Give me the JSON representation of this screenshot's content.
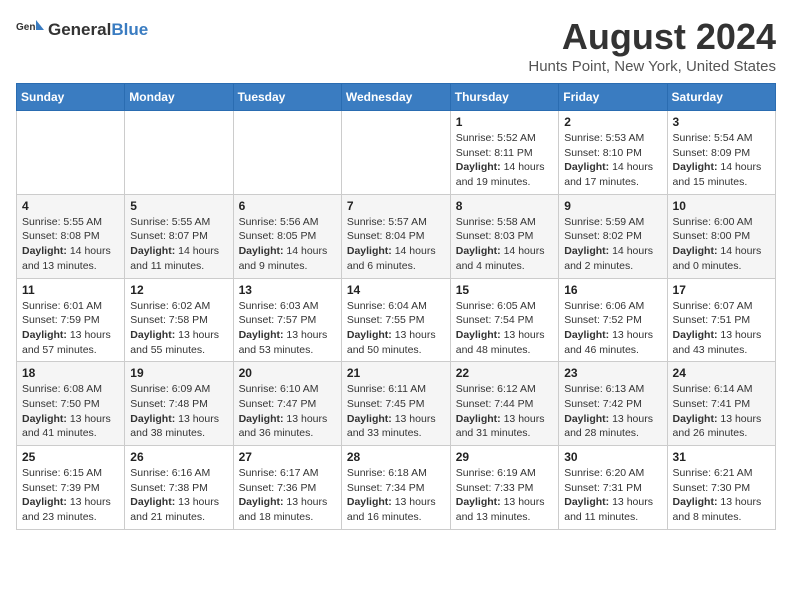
{
  "header": {
    "logo_general": "General",
    "logo_blue": "Blue",
    "month": "August 2024",
    "location": "Hunts Point, New York, United States"
  },
  "weekdays": [
    "Sunday",
    "Monday",
    "Tuesday",
    "Wednesday",
    "Thursday",
    "Friday",
    "Saturday"
  ],
  "weeks": [
    [
      {
        "day": "",
        "text": ""
      },
      {
        "day": "",
        "text": ""
      },
      {
        "day": "",
        "text": ""
      },
      {
        "day": "",
        "text": ""
      },
      {
        "day": "1",
        "text": "Sunrise: 5:52 AM\nSunset: 8:11 PM\nDaylight: 14 hours and 19 minutes."
      },
      {
        "day": "2",
        "text": "Sunrise: 5:53 AM\nSunset: 8:10 PM\nDaylight: 14 hours and 17 minutes."
      },
      {
        "day": "3",
        "text": "Sunrise: 5:54 AM\nSunset: 8:09 PM\nDaylight: 14 hours and 15 minutes."
      }
    ],
    [
      {
        "day": "4",
        "text": "Sunrise: 5:55 AM\nSunset: 8:08 PM\nDaylight: 14 hours and 13 minutes."
      },
      {
        "day": "5",
        "text": "Sunrise: 5:55 AM\nSunset: 8:07 PM\nDaylight: 14 hours and 11 minutes."
      },
      {
        "day": "6",
        "text": "Sunrise: 5:56 AM\nSunset: 8:05 PM\nDaylight: 14 hours and 9 minutes."
      },
      {
        "day": "7",
        "text": "Sunrise: 5:57 AM\nSunset: 8:04 PM\nDaylight: 14 hours and 6 minutes."
      },
      {
        "day": "8",
        "text": "Sunrise: 5:58 AM\nSunset: 8:03 PM\nDaylight: 14 hours and 4 minutes."
      },
      {
        "day": "9",
        "text": "Sunrise: 5:59 AM\nSunset: 8:02 PM\nDaylight: 14 hours and 2 minutes."
      },
      {
        "day": "10",
        "text": "Sunrise: 6:00 AM\nSunset: 8:00 PM\nDaylight: 14 hours and 0 minutes."
      }
    ],
    [
      {
        "day": "11",
        "text": "Sunrise: 6:01 AM\nSunset: 7:59 PM\nDaylight: 13 hours and 57 minutes."
      },
      {
        "day": "12",
        "text": "Sunrise: 6:02 AM\nSunset: 7:58 PM\nDaylight: 13 hours and 55 minutes."
      },
      {
        "day": "13",
        "text": "Sunrise: 6:03 AM\nSunset: 7:57 PM\nDaylight: 13 hours and 53 minutes."
      },
      {
        "day": "14",
        "text": "Sunrise: 6:04 AM\nSunset: 7:55 PM\nDaylight: 13 hours and 50 minutes."
      },
      {
        "day": "15",
        "text": "Sunrise: 6:05 AM\nSunset: 7:54 PM\nDaylight: 13 hours and 48 minutes."
      },
      {
        "day": "16",
        "text": "Sunrise: 6:06 AM\nSunset: 7:52 PM\nDaylight: 13 hours and 46 minutes."
      },
      {
        "day": "17",
        "text": "Sunrise: 6:07 AM\nSunset: 7:51 PM\nDaylight: 13 hours and 43 minutes."
      }
    ],
    [
      {
        "day": "18",
        "text": "Sunrise: 6:08 AM\nSunset: 7:50 PM\nDaylight: 13 hours and 41 minutes."
      },
      {
        "day": "19",
        "text": "Sunrise: 6:09 AM\nSunset: 7:48 PM\nDaylight: 13 hours and 38 minutes."
      },
      {
        "day": "20",
        "text": "Sunrise: 6:10 AM\nSunset: 7:47 PM\nDaylight: 13 hours and 36 minutes."
      },
      {
        "day": "21",
        "text": "Sunrise: 6:11 AM\nSunset: 7:45 PM\nDaylight: 13 hours and 33 minutes."
      },
      {
        "day": "22",
        "text": "Sunrise: 6:12 AM\nSunset: 7:44 PM\nDaylight: 13 hours and 31 minutes."
      },
      {
        "day": "23",
        "text": "Sunrise: 6:13 AM\nSunset: 7:42 PM\nDaylight: 13 hours and 28 minutes."
      },
      {
        "day": "24",
        "text": "Sunrise: 6:14 AM\nSunset: 7:41 PM\nDaylight: 13 hours and 26 minutes."
      }
    ],
    [
      {
        "day": "25",
        "text": "Sunrise: 6:15 AM\nSunset: 7:39 PM\nDaylight: 13 hours and 23 minutes."
      },
      {
        "day": "26",
        "text": "Sunrise: 6:16 AM\nSunset: 7:38 PM\nDaylight: 13 hours and 21 minutes."
      },
      {
        "day": "27",
        "text": "Sunrise: 6:17 AM\nSunset: 7:36 PM\nDaylight: 13 hours and 18 minutes."
      },
      {
        "day": "28",
        "text": "Sunrise: 6:18 AM\nSunset: 7:34 PM\nDaylight: 13 hours and 16 minutes."
      },
      {
        "day": "29",
        "text": "Sunrise: 6:19 AM\nSunset: 7:33 PM\nDaylight: 13 hours and 13 minutes."
      },
      {
        "day": "30",
        "text": "Sunrise: 6:20 AM\nSunset: 7:31 PM\nDaylight: 13 hours and 11 minutes."
      },
      {
        "day": "31",
        "text": "Sunrise: 6:21 AM\nSunset: 7:30 PM\nDaylight: 13 hours and 8 minutes."
      }
    ]
  ]
}
